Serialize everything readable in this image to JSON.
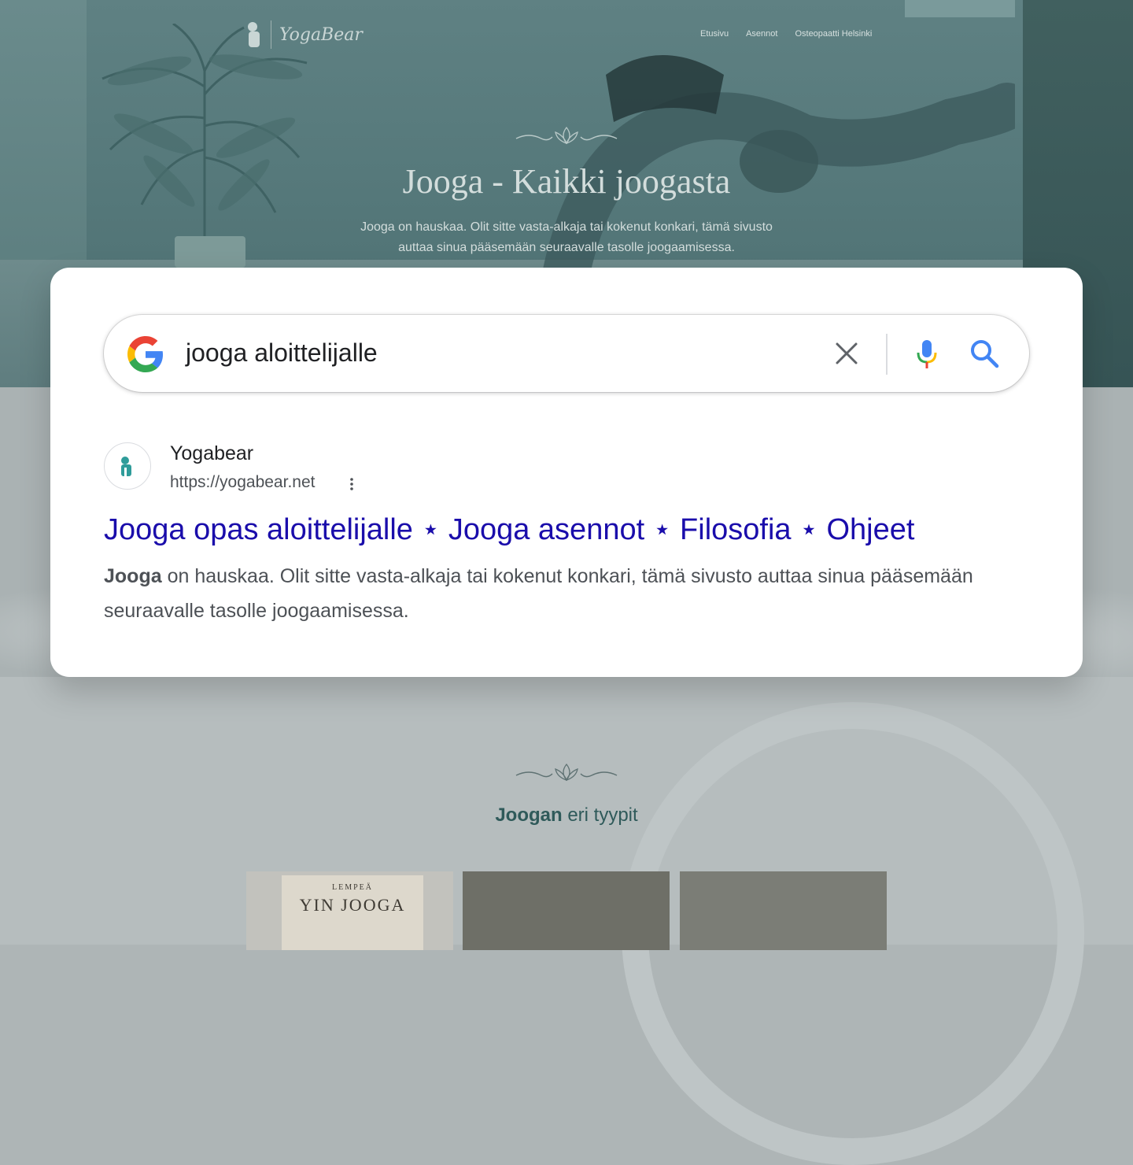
{
  "background_site": {
    "logo_text": "YogaBear",
    "nav": [
      "Etusivu",
      "Asennot",
      "Osteopaatti Helsinki"
    ],
    "hero_title": "Jooga - Kaikki joogasta",
    "hero_subtitle_line1": "Jooga on hauskaa. Olit sitte vasta-alkaja tai kokenut konkari, tämä sivusto",
    "hero_subtitle_line2": "auttaa sinua pääsemään seuraavalle tasolle joogaamisessa.",
    "section_title_bold": "Joogan",
    "section_title_rest": " eri tyypit",
    "card1_small": "LEMPEÄ",
    "card1_big": "YIN JOOGA"
  },
  "search": {
    "query": "jooga aloittelijalle",
    "icons": [
      "google-g-icon",
      "clear-icon",
      "mic-icon",
      "search-icon"
    ]
  },
  "result": {
    "site_name": "Yogabear",
    "url": "https://yogabear.net",
    "title": "Jooga opas aloittelijalle ⋆ Jooga asennot ⋆ Filosofia ⋆ Ohjeet",
    "snippet_bold": "Jooga",
    "snippet_rest": " on hauskaa. Olit sitte vasta-alkaja tai kokenut konkari, tämä sivusto auttaa sinua pääsemään seuraavalle tasolle joogaamisessa."
  },
  "colors": {
    "link": "#1a0dab",
    "snippet": "#4d5156",
    "google_blue": "#4285F4",
    "google_red": "#EA4335",
    "google_yellow": "#FBBC05",
    "google_green": "#34A853",
    "teal_brand": "#2f9c9a"
  }
}
